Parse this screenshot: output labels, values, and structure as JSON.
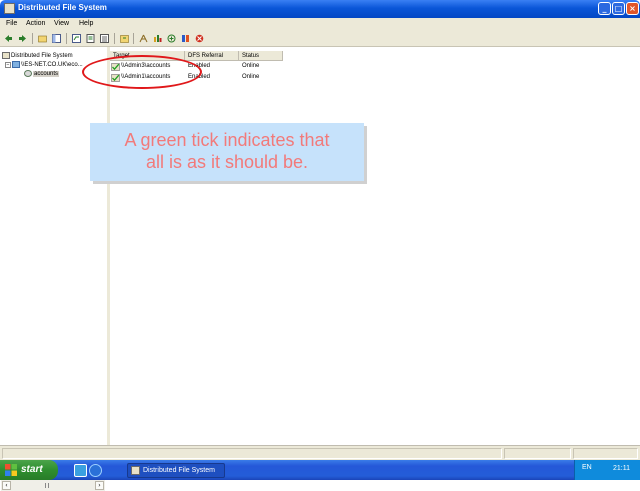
{
  "window": {
    "title": "Distributed File System",
    "controls": {
      "minimize": "_",
      "maximize": "□",
      "close": "×"
    }
  },
  "menu": {
    "file": "File",
    "action": "Action",
    "view": "View",
    "help": "Help"
  },
  "toolbar_icons": [
    "back-icon",
    "forward-icon",
    "up-folder-icon",
    "show-hide-tree-icon",
    "refresh-icon",
    "properties-icon",
    "export-list-icon",
    "help-icon",
    "new-root-icon",
    "new-link-icon",
    "add-target-icon",
    "status-icon",
    "replication-icon",
    "remove-icon"
  ],
  "tree": {
    "root": "Distributed File System",
    "namespace": "\\\\ES-NET.CO.UK\\eco...",
    "link": "accounts"
  },
  "list": {
    "columns": [
      "Target",
      "DFS Referral",
      "Status"
    ],
    "rows": [
      {
        "target": "\\\\Admin3\\accounts",
        "referral": "Enabled",
        "status": "Online"
      },
      {
        "target": "\\\\Admin1\\accounts",
        "referral": "Enabled",
        "status": "Online"
      }
    ]
  },
  "callout": {
    "line1": "A green tick indicates that",
    "line2": "all is as it should be."
  },
  "colors": {
    "annotation": "#e0181a",
    "callout_bg": "#c6e2fb",
    "callout_text": "#f27a7a",
    "tick": "#1f9e1f"
  },
  "taskbar": {
    "start_label": "start",
    "task_label": "Distributed File System",
    "language": "EN",
    "clock": "21:11"
  }
}
